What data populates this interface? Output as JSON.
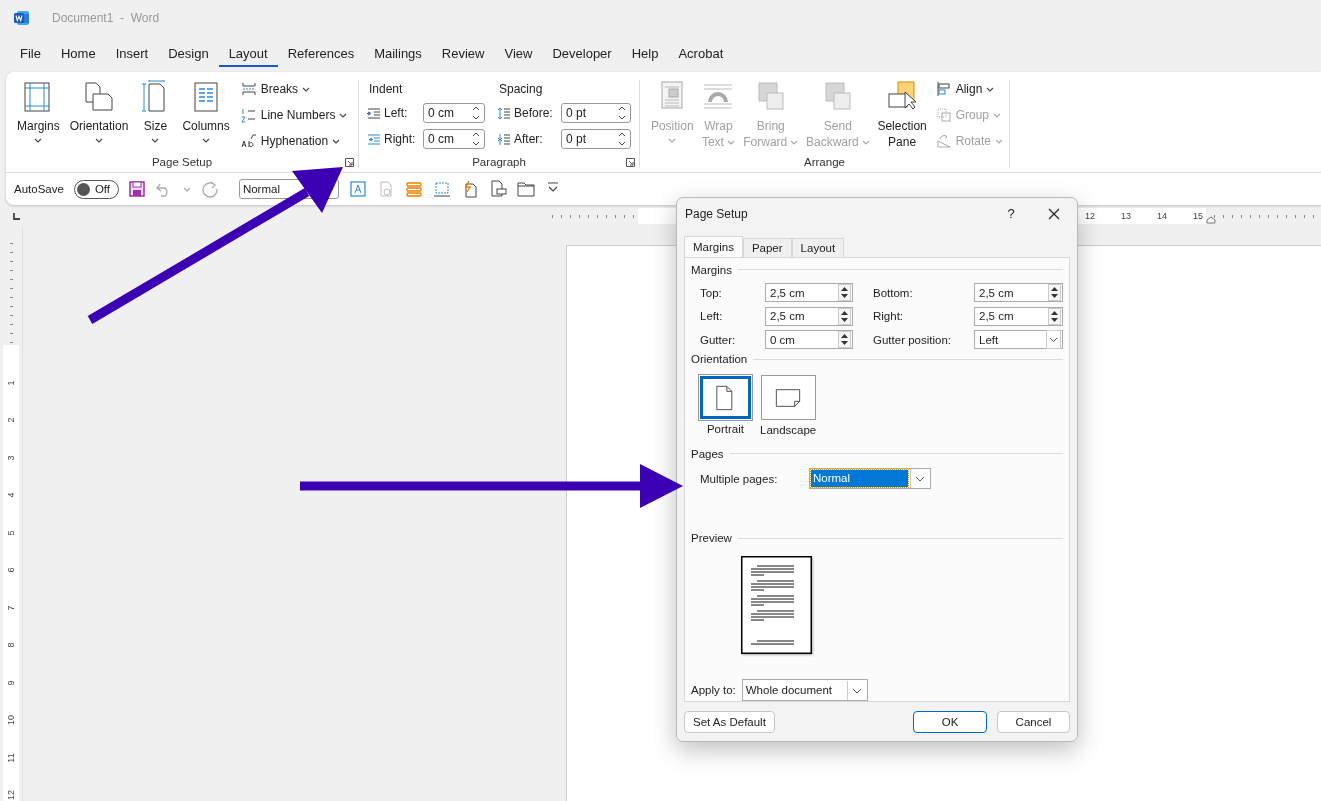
{
  "window": {
    "title": "Document1  -  Word"
  },
  "menu_tabs": [
    {
      "label": "File",
      "selected": false
    },
    {
      "label": "Home",
      "selected": false
    },
    {
      "label": "Insert",
      "selected": false
    },
    {
      "label": "Design",
      "selected": false
    },
    {
      "label": "Layout",
      "selected": true
    },
    {
      "label": "References",
      "selected": false
    },
    {
      "label": "Mailings",
      "selected": false
    },
    {
      "label": "Review",
      "selected": false
    },
    {
      "label": "View",
      "selected": false
    },
    {
      "label": "Developer",
      "selected": false
    },
    {
      "label": "Help",
      "selected": false
    },
    {
      "label": "Acrobat",
      "selected": false
    }
  ],
  "ribbon": {
    "page_setup": {
      "label": "Page Setup",
      "large_buttons": [
        {
          "lines": [
            "Margins"
          ],
          "menu": true
        },
        {
          "lines": [
            "Orientation"
          ],
          "menu": true
        },
        {
          "lines": [
            "Size"
          ],
          "menu": true
        },
        {
          "lines": [
            "Columns"
          ],
          "menu": true
        }
      ],
      "small_buttons": [
        {
          "label": "Breaks",
          "menu": true
        },
        {
          "label": "Line Numbers",
          "menu": true
        },
        {
          "label": "Hyphenation",
          "menu": true
        }
      ]
    },
    "paragraph": {
      "label": "Paragraph",
      "indent": {
        "heading": "Indent",
        "fields": [
          {
            "label": "Left:",
            "value": "0 cm"
          },
          {
            "label": "Right:",
            "value": "0 cm"
          }
        ]
      },
      "spacing": {
        "heading": "Spacing",
        "fields": [
          {
            "label": "Before:",
            "value": "0 pt"
          },
          {
            "label": "After:",
            "value": "0 pt"
          }
        ]
      }
    },
    "arrange": {
      "label": "Arrange",
      "large_buttons": [
        {
          "lines": [
            "Position"
          ],
          "menu": true,
          "disabled": true
        },
        {
          "lines": [
            "Wrap",
            "Text"
          ],
          "menu": true,
          "disabled": true
        },
        {
          "lines": [
            "Bring",
            "Forward"
          ],
          "menu": true,
          "disabled": true
        },
        {
          "lines": [
            "Send",
            "Backward"
          ],
          "menu": true,
          "disabled": true
        },
        {
          "lines": [
            "Selection",
            "Pane"
          ],
          "menu": false,
          "disabled": false
        }
      ],
      "small_buttons": [
        {
          "label": "Align",
          "menu": true,
          "disabled": false
        },
        {
          "label": "Group",
          "menu": true,
          "disabled": true
        },
        {
          "label": "Rotate",
          "menu": true,
          "disabled": true
        }
      ]
    }
  },
  "quick_access": {
    "autosave": {
      "label": "AutoSave",
      "state": "Off",
      "on": false
    },
    "style_box": {
      "value": "Normal"
    }
  },
  "horizontal_ruler": {
    "numbers": [
      "12",
      "13",
      "14",
      "15"
    ]
  },
  "vertical_ruler": {
    "numbers": [
      "1",
      "2",
      "3",
      "4",
      "5",
      "6",
      "7",
      "8",
      "9",
      "10",
      "11",
      "12"
    ]
  },
  "dialog": {
    "title": "Page Setup",
    "help": "?",
    "tabs": [
      {
        "label": "Margins",
        "selected": true
      },
      {
        "label": "Paper",
        "selected": false
      },
      {
        "label": "Layout",
        "selected": false
      }
    ],
    "margins": {
      "heading": "Margins",
      "fields": [
        {
          "label": "Top:",
          "value": "2,5 cm",
          "kind": "spin"
        },
        {
          "label": "Bottom:",
          "value": "2,5 cm",
          "kind": "spin"
        },
        {
          "label": "Left:",
          "value": "2,5 cm",
          "kind": "spin"
        },
        {
          "label": "Right:",
          "value": "2,5 cm",
          "kind": "spin"
        },
        {
          "label": "Gutter:",
          "value": "0 cm",
          "kind": "spin"
        },
        {
          "label": "Gutter position:",
          "value": "Left",
          "kind": "select"
        }
      ]
    },
    "orientation": {
      "heading": "Orientation",
      "options": [
        {
          "label": "Portrait",
          "selected": true
        },
        {
          "label": "Landscape",
          "selected": false
        }
      ]
    },
    "pages": {
      "heading": "Pages",
      "multiple_pages": {
        "label": "Multiple pages:",
        "value": "Normal",
        "focused": true
      }
    },
    "preview": {
      "heading": "Preview"
    },
    "apply_to": {
      "label": "Apply to:",
      "value": "Whole document"
    },
    "buttons": [
      {
        "label": "Set As Default",
        "default": false
      },
      {
        "label": "OK",
        "default": true
      },
      {
        "label": "Cancel",
        "default": false
      }
    ]
  }
}
